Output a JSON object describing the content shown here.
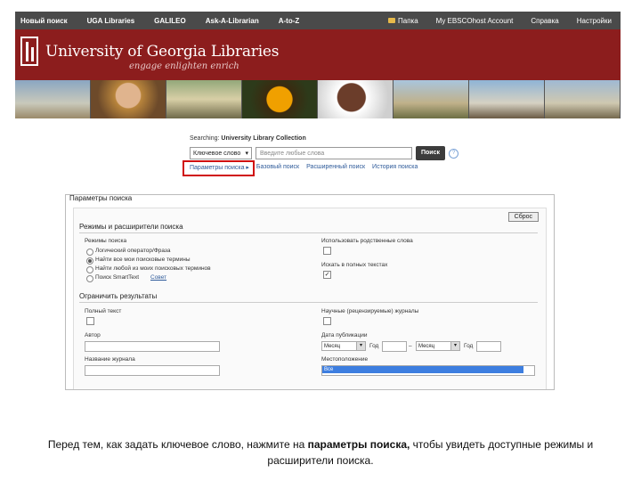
{
  "nav": {
    "left": [
      "Новый поиск",
      "UGA Libraries",
      "GALILEO",
      "Ask-A-Librarian",
      "A-to-Z"
    ],
    "right": [
      "Папка",
      "My EBSCOhost Account",
      "Справка",
      "Настройки"
    ]
  },
  "banner": {
    "title": "University of Georgia Libraries",
    "tagline": "engage enlighten enrich"
  },
  "search": {
    "searching_label": "Searching:",
    "collection": "University Library Collection",
    "field_select": "Ключевое слово",
    "placeholder": "Введите любые слова",
    "button": "Поиск",
    "help": "?",
    "links": [
      "Параметры поиска ▸",
      "Базовый поиск",
      "Расширенный поиск",
      "История поиска"
    ]
  },
  "panel": {
    "title": "Параметры поиска",
    "reset": "Сброс",
    "modes_heading": "Режимы и расширители поиска",
    "modes_label": "Режимы поиска",
    "modes": [
      "Логический оператор/Фраза",
      "Найти все мои поисковые термины",
      "Найти любой из моих поисковых терминов",
      "Поиск SmartText"
    ],
    "modes_hint": "Совет",
    "related_words": "Использовать родственные слова",
    "full_text_search": "Искать в полных текстах",
    "limit_heading": "Ограничить результаты",
    "full_text": "Полный текст",
    "peer_reviewed": "Научные (рецензируемые) журналы",
    "author": "Автор",
    "pub_date": "Дата публикации",
    "month1": "Месяц",
    "year1": "Год",
    "dash": "–",
    "month2": "Месяц",
    "year2": "Год",
    "journal_title": "Название журнала",
    "location": "Местоположение",
    "location_selected": "Все"
  },
  "caption": {
    "before": "Перед тем, как задать ключевое слово, нажмите на ",
    "bold": "параметры поиска,",
    "after": " чтобы увидеть доступные режимы и расширители поиска."
  }
}
